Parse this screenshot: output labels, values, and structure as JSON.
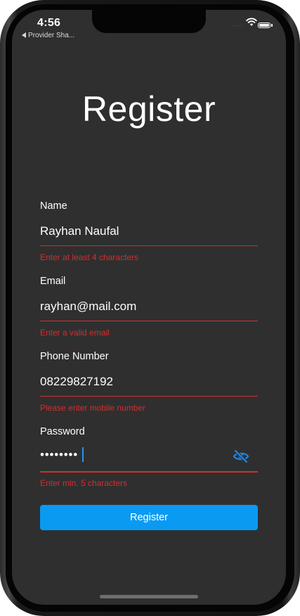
{
  "status_bar": {
    "time": "4:56",
    "back_label": "Provider Sha...",
    "signal": "....",
    "icons": [
      "back-triangle-icon",
      "wifi-icon",
      "battery-icon"
    ]
  },
  "screen": {
    "title": "Register"
  },
  "form": {
    "name": {
      "label": "Name",
      "value": "Rayhan Naufal",
      "error": "Enter at least 4 characters"
    },
    "email": {
      "label": "Email",
      "value": "rayhan@mail.com",
      "error": "Enter a valid email"
    },
    "phone": {
      "label": "Phone Number",
      "value": "08229827192",
      "error": "Please enter mobile number"
    },
    "password": {
      "label": "Password",
      "masked_value": "••••••••",
      "error": "Enter min. 5 characters",
      "toggle_icon": "eye-off-icon"
    },
    "submit_label": "Register"
  },
  "colors": {
    "background": "#2f2f2f",
    "error": "#d32f2f",
    "accent": "#0a9af2",
    "cursor": "#2196f3"
  }
}
